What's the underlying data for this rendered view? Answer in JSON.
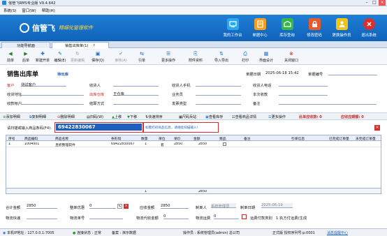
{
  "window": {
    "title": "信管飞RMS专业版 V9.4.642"
  },
  "menu": [
    "系统(S)",
    "窗口(W)",
    "帮助(H)"
  ],
  "brand": {
    "name": "信管飞",
    "tagline": "精细化管理软件"
  },
  "nav": [
    {
      "label": "我的工作台",
      "color": "#2aa8f0"
    },
    {
      "label": "单据中心",
      "color": "#f2a01f"
    },
    {
      "label": "库存查询",
      "color": "#39b54a"
    },
    {
      "label": "修改密码",
      "color": "#e85a2b"
    },
    {
      "label": "更换操作员",
      "color": "#f0c419"
    },
    {
      "label": "退出系统",
      "color": "#d9302c"
    }
  ],
  "tabs": [
    "功能导航面",
    "销售出库单(1)"
  ],
  "toolbar": [
    "前单",
    "后单",
    "新建开单",
    "编辑(E)",
    "更新编辑",
    "保存(Q)",
    "审核(A)",
    "引单",
    "更多操作",
    "附件资料",
    "导入导出",
    "打印",
    "界面设计",
    "关闭窗口"
  ],
  "doc": {
    "title": "销售出库单",
    "status": "待出库",
    "date_label": "单据日期",
    "date": "2025-06-18 15:42",
    "no_label": "单据编号"
  },
  "form": {
    "customer_label": "客户",
    "customer": "测试客户",
    "contact_label": "收货人",
    "phone_label": "收货人手机",
    "tel_label": "收货人电话",
    "address_label": "收货地址",
    "warehouse_label": "出库仓库",
    "warehouse": "王仓库",
    "salesman_label": "业务员",
    "discount_label": "本次收款",
    "account_label": "收款帐户",
    "settle_label": "结算方式",
    "invoice_label": "发票类型",
    "remark_label": "备注"
  },
  "itembar": {
    "add": "添加明细",
    "copy": "复制明细",
    "delete": "删除明细",
    "scan": "扫码(W)",
    "up": "上移",
    "down": "下移",
    "sort": "快速排序",
    "size": "尺码兵站",
    "stock": "查看库存",
    "history": "查看商品详情",
    "more": "更多操作",
    "received": "此单应收款: 0",
    "receivable": "应收应期额: 0"
  },
  "scanner": {
    "label": "请扫描或输入商品条码(F4):",
    "value": "69422830067",
    "hint": "如需打初商品信息，请继续扫描输入！"
  },
  "grid": {
    "headers": [
      "序号",
      "商品编码",
      "商品名称",
      "条形码",
      "数量",
      "单位",
      "单价",
      "金额",
      "赠品",
      "备注",
      "引单信息",
      "已完成订单量",
      "未完成订单量"
    ],
    "rows": [
      [
        "1",
        "1004001",
        "且摇整理软件",
        "69422830067",
        "1",
        "套",
        "2850",
        "2850",
        "",
        "",
        "",
        "",
        ""
      ]
    ],
    "footer": {
      "qty": "1",
      "amount": "2850"
    }
  },
  "bottom": {
    "total_label": "合计金额",
    "total": "2850",
    "disc_label": "整单优惠",
    "disc": "0",
    "due_label": "应收金额",
    "due": "2850",
    "maker_label": "制单人",
    "maker": "系统管理员",
    "mdate_label": "制单日期",
    "mdate": "2025-06-19",
    "ship_label": "物流快递",
    "ship_no_label": "物流单号",
    "ship_fee_label": "物流代收金额",
    "ship_fee": "0",
    "freight_label": "物流运费",
    "freight": "0",
    "pay_label": "运费付款类别",
    "pay": "1 执方付运费(生成"
  },
  "status": {
    "ip": "本机IP地址 : 127.0.0.1:7005",
    "conn": "连接状态 : 正常",
    "mode": "备案 : 演示数据",
    "user": "操作员 : 系统管理员(admin) 总公司",
    "build": "正式版 授权序列号:p:0001",
    "center": "消息提醒中心"
  }
}
